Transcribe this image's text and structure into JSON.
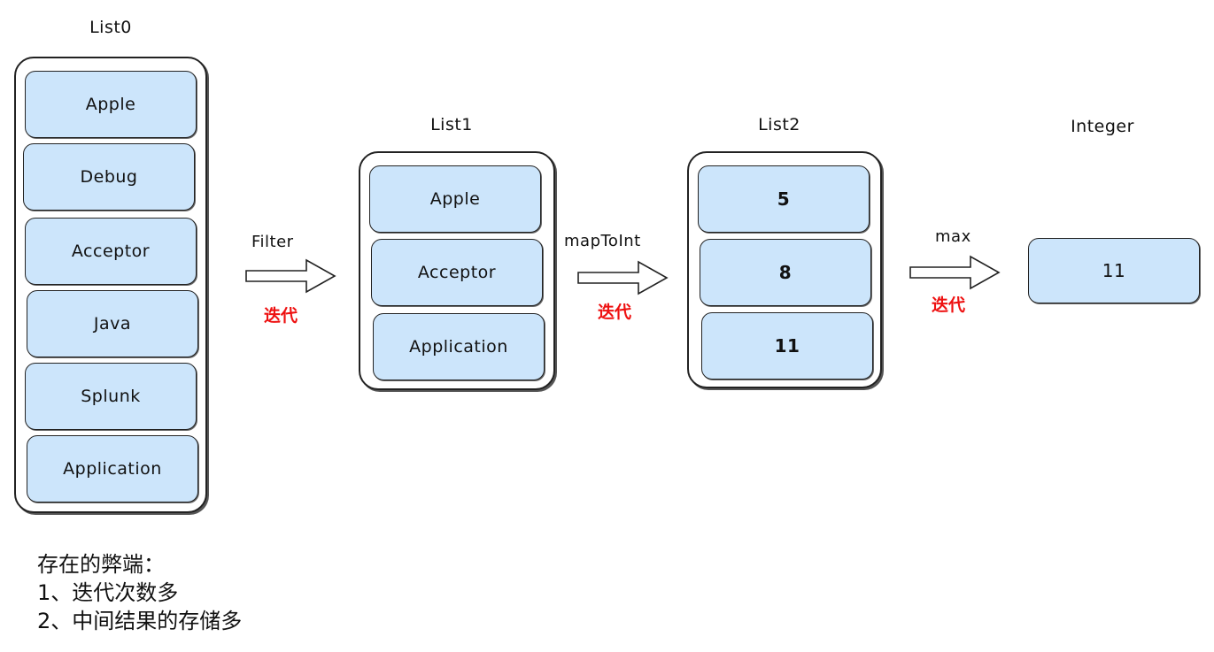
{
  "lists": [
    {
      "title": "List0",
      "items": [
        "Apple",
        "Debug",
        "Acceptor",
        "Java",
        "Splunk",
        "Application"
      ]
    },
    {
      "title": "List1",
      "items": [
        "Apple",
        "Acceptor",
        "Application"
      ]
    },
    {
      "title": "List2",
      "items": [
        "5",
        "8",
        "11"
      ]
    },
    {
      "title": "Integer",
      "items": [
        "11"
      ]
    }
  ],
  "operations": [
    {
      "label": "Filter",
      "iteration_label": "迭代"
    },
    {
      "label": "mapToInt",
      "iteration_label": "迭代"
    },
    {
      "label": "max",
      "iteration_label": "迭代"
    }
  ],
  "notes": {
    "heading": "存在的弊端：",
    "points": [
      "1、迭代次数多",
      "2、中间结果的存储多"
    ]
  },
  "colors": {
    "cell_fill": "#cce5fb",
    "iteration_label": "#ee1111"
  }
}
